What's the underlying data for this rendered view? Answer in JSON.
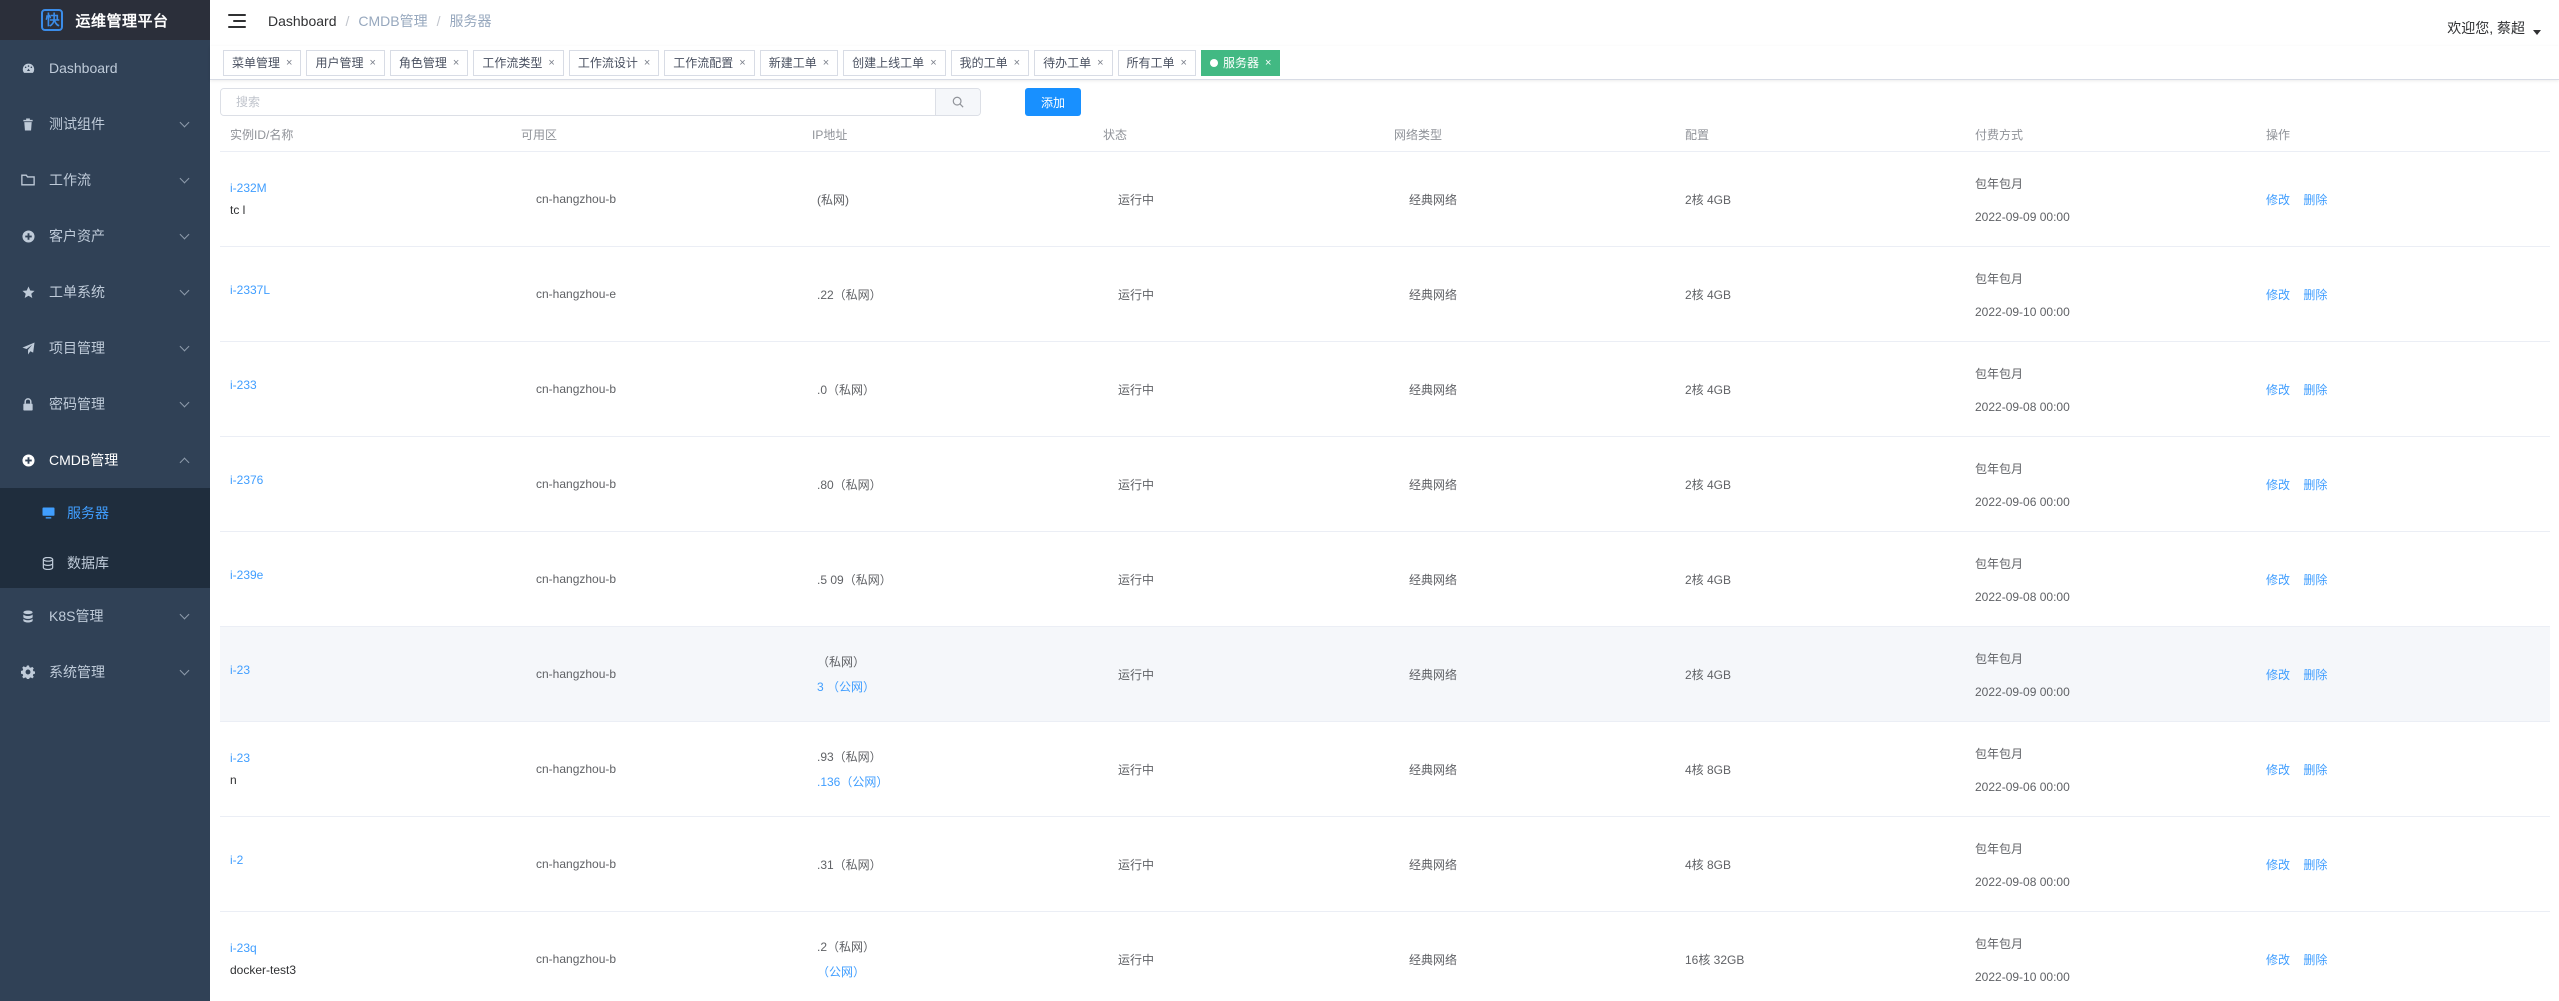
{
  "app": {
    "title": "运维管理平台"
  },
  "sidebar": {
    "items": [
      {
        "label": "Dashboard",
        "icon": "dashboard-icon"
      },
      {
        "label": "测试组件",
        "icon": "trash-icon"
      },
      {
        "label": "工作流",
        "icon": "folder-icon"
      },
      {
        "label": "客户资产",
        "icon": "plus-circle-icon"
      },
      {
        "label": "工单系统",
        "icon": "star-icon"
      },
      {
        "label": "项目管理",
        "icon": "send-icon"
      },
      {
        "label": "密码管理",
        "icon": "lock-icon"
      },
      {
        "label": "CMDB管理",
        "icon": "plus-circle-icon"
      },
      {
        "label": "K8S管理",
        "icon": "database-icon"
      },
      {
        "label": "系统管理",
        "icon": "gear-icon"
      }
    ],
    "cmdb_sub": [
      {
        "label": "服务器",
        "icon": "monitor-icon"
      },
      {
        "label": "数据库",
        "icon": "database-icon"
      }
    ]
  },
  "header": {
    "breadcrumb": [
      "Dashboard",
      "CMDB管理",
      "服务器"
    ],
    "breadcrumb_sep": "/",
    "welcome": "欢迎您, 蔡超"
  },
  "tags": [
    {
      "label": "菜单管理"
    },
    {
      "label": "用户管理"
    },
    {
      "label": "角色管理"
    },
    {
      "label": "工作流类型"
    },
    {
      "label": "工作流设计"
    },
    {
      "label": "工作流配置"
    },
    {
      "label": "新建工单"
    },
    {
      "label": "创建上线工单"
    },
    {
      "label": "我的工单"
    },
    {
      "label": "待办工单"
    },
    {
      "label": "所有工单"
    },
    {
      "label": "服务器"
    }
  ],
  "tag_close": "×",
  "toolbar": {
    "search_placeholder": "搜索",
    "add_label": "添加"
  },
  "table": {
    "headers": [
      "实例ID/名称",
      "可用区",
      "IP地址",
      "状态",
      "网络类型",
      "配置",
      "付费方式",
      "操作"
    ],
    "edit_label": "修改",
    "delete_label": "删除",
    "rows": [
      {
        "id": "i-232M",
        "name": "tc l",
        "zone": "cn-hangzhou-b",
        "ip_private": "(私网)",
        "ip_public": "",
        "status": "运行中",
        "net": "经典网络",
        "config": "2核 4GB",
        "pay": "包年包月",
        "expire": "2022-09-09 00:00"
      },
      {
        "id": "i-2337L",
        "name": "",
        "zone": "cn-hangzhou-e",
        "ip_private": ".22（私网）",
        "ip_public": "",
        "status": "运行中",
        "net": "经典网络",
        "config": "2核 4GB",
        "pay": "包年包月",
        "expire": "2022-09-10 00:00"
      },
      {
        "id": "i-233",
        "name": "",
        "zone": "cn-hangzhou-b",
        "ip_private": ".0（私网）",
        "ip_public": "",
        "status": "运行中",
        "net": "经典网络",
        "config": "2核 4GB",
        "pay": "包年包月",
        "expire": "2022-09-08 00:00"
      },
      {
        "id": "i-2376",
        "name": "",
        "zone": "cn-hangzhou-b",
        "ip_private": ".80（私网）",
        "ip_public": "",
        "status": "运行中",
        "net": "经典网络",
        "config": "2核 4GB",
        "pay": "包年包月",
        "expire": "2022-09-06 00:00"
      },
      {
        "id": "i-239e",
        "name": "",
        "zone": "cn-hangzhou-b",
        "ip_private": ".5 09（私网）",
        "ip_public": "",
        "status": "运行中",
        "net": "经典网络",
        "config": "2核 4GB",
        "pay": "包年包月",
        "expire": "2022-09-08 00:00"
      },
      {
        "id": "i-23",
        "name": "",
        "zone": "cn-hangzhou-b",
        "ip_private": "（私网）",
        "ip_public": "3 （公网）",
        "status": "运行中",
        "net": "经典网络",
        "config": "2核 4GB",
        "pay": "包年包月",
        "expire": "2022-09-09 00:00"
      },
      {
        "id": "i-23",
        "name": "n",
        "zone": "cn-hangzhou-b",
        "ip_private": ".93（私网）",
        "ip_public": ".136（公网）",
        "status": "运行中",
        "net": "经典网络",
        "config": "4核 8GB",
        "pay": "包年包月",
        "expire": "2022-09-06 00:00"
      },
      {
        "id": "i-2",
        "name": "",
        "zone": "cn-hangzhou-b",
        "ip_private": ".31（私网）",
        "ip_public": "",
        "status": "运行中",
        "net": "经典网络",
        "config": "4核 8GB",
        "pay": "包年包月",
        "expire": "2022-09-08 00:00"
      },
      {
        "id": "i-23q",
        "name": "docker-test3",
        "zone": "cn-hangzhou-b",
        "ip_private": ".2（私网）",
        "ip_public": "（公网）",
        "status": "运行中",
        "net": "经典网络",
        "config": "16核 32GB",
        "pay": "包年包月",
        "expire": "2022-09-10 00:00"
      }
    ]
  },
  "colors": {
    "sidebar_bg": "#304156",
    "active_menu": "#409eff",
    "active_tag": "#42b983",
    "primary_button": "#1890ff",
    "link": "#409eff"
  }
}
